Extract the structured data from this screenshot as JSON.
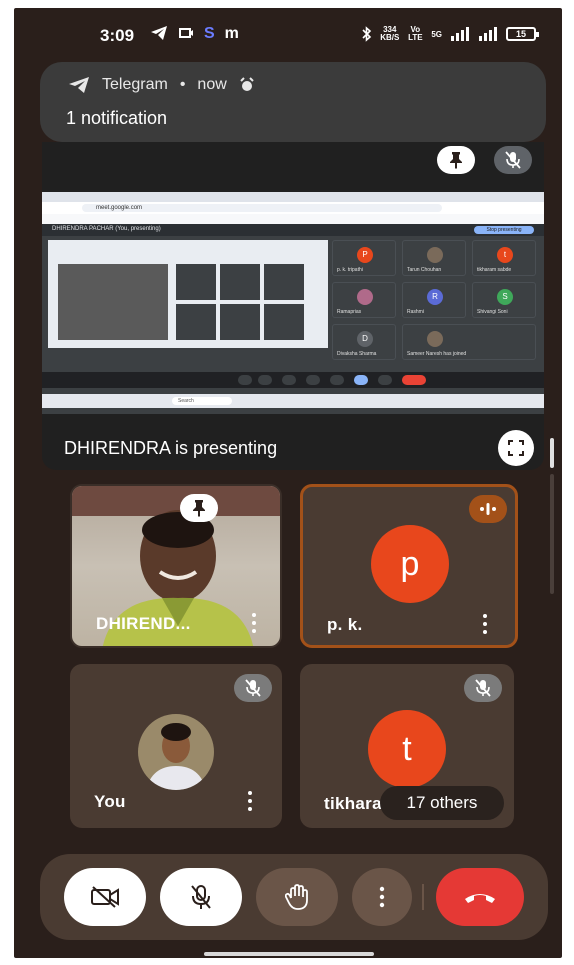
{
  "status_bar": {
    "time": "3:09",
    "app_letters": [
      "S",
      "m"
    ],
    "net_speed_top": "334",
    "net_speed_bottom": "KB/S",
    "volte": "Vo LTE",
    "network": "5G",
    "battery": "15"
  },
  "notification": {
    "app": "Telegram",
    "separator": "•",
    "when": "now",
    "text": "1 notification"
  },
  "presentation": {
    "label": "DHIRENDRA is presenting",
    "shared_screen": {
      "meet_title": "DHIRENDRA PACHAR (You, presenting)",
      "stop_button": "Stop presenting",
      "url": "meet.google.com",
      "search_label": "Search",
      "tiles": [
        {
          "initial": "P",
          "name": "p. k. tripathi",
          "color": "#e8471c"
        },
        {
          "initial": "",
          "name": "Tarun Chouhan",
          "color": "#7a6a5a"
        },
        {
          "initial": "t",
          "name": "tikharam sabde",
          "color": "#e8471c"
        },
        {
          "initial": "",
          "name": "Ramaprias",
          "color": "#b06a8a"
        },
        {
          "initial": "R",
          "name": "Rashmi",
          "color": "#5b6bd6"
        },
        {
          "initial": "S",
          "name": "Shivangi Soni",
          "color": "#3fa85a"
        },
        {
          "initial": "D",
          "name": "Divaksha Sharma",
          "color": "#5f6368"
        },
        {
          "initial": "",
          "name": "Sameer Naresh has joined",
          "color": "#7a6a5a"
        }
      ]
    }
  },
  "participants": [
    {
      "name": "DHIREND...",
      "type": "video"
    },
    {
      "name": "p. k.",
      "initial": "p",
      "type": "avatar"
    },
    {
      "name": "You",
      "type": "photo"
    },
    {
      "name": "tikharam",
      "initial": "t",
      "type": "avatar"
    }
  ],
  "others": "17 others",
  "colors": {
    "background": "#2a1f1b",
    "tile": "#4a3b32",
    "speaking_border": "#a35119",
    "avatar": "#e8471c",
    "end_call": "#e53935"
  },
  "icons": {
    "pin": "pin-icon",
    "mic_off": "mic-off-icon",
    "fullscreen": "fullscreen-icon",
    "camera_off": "camera-off-icon",
    "raise_hand": "raise-hand-icon",
    "more": "more-vert-icon",
    "end_call": "end-call-icon"
  }
}
